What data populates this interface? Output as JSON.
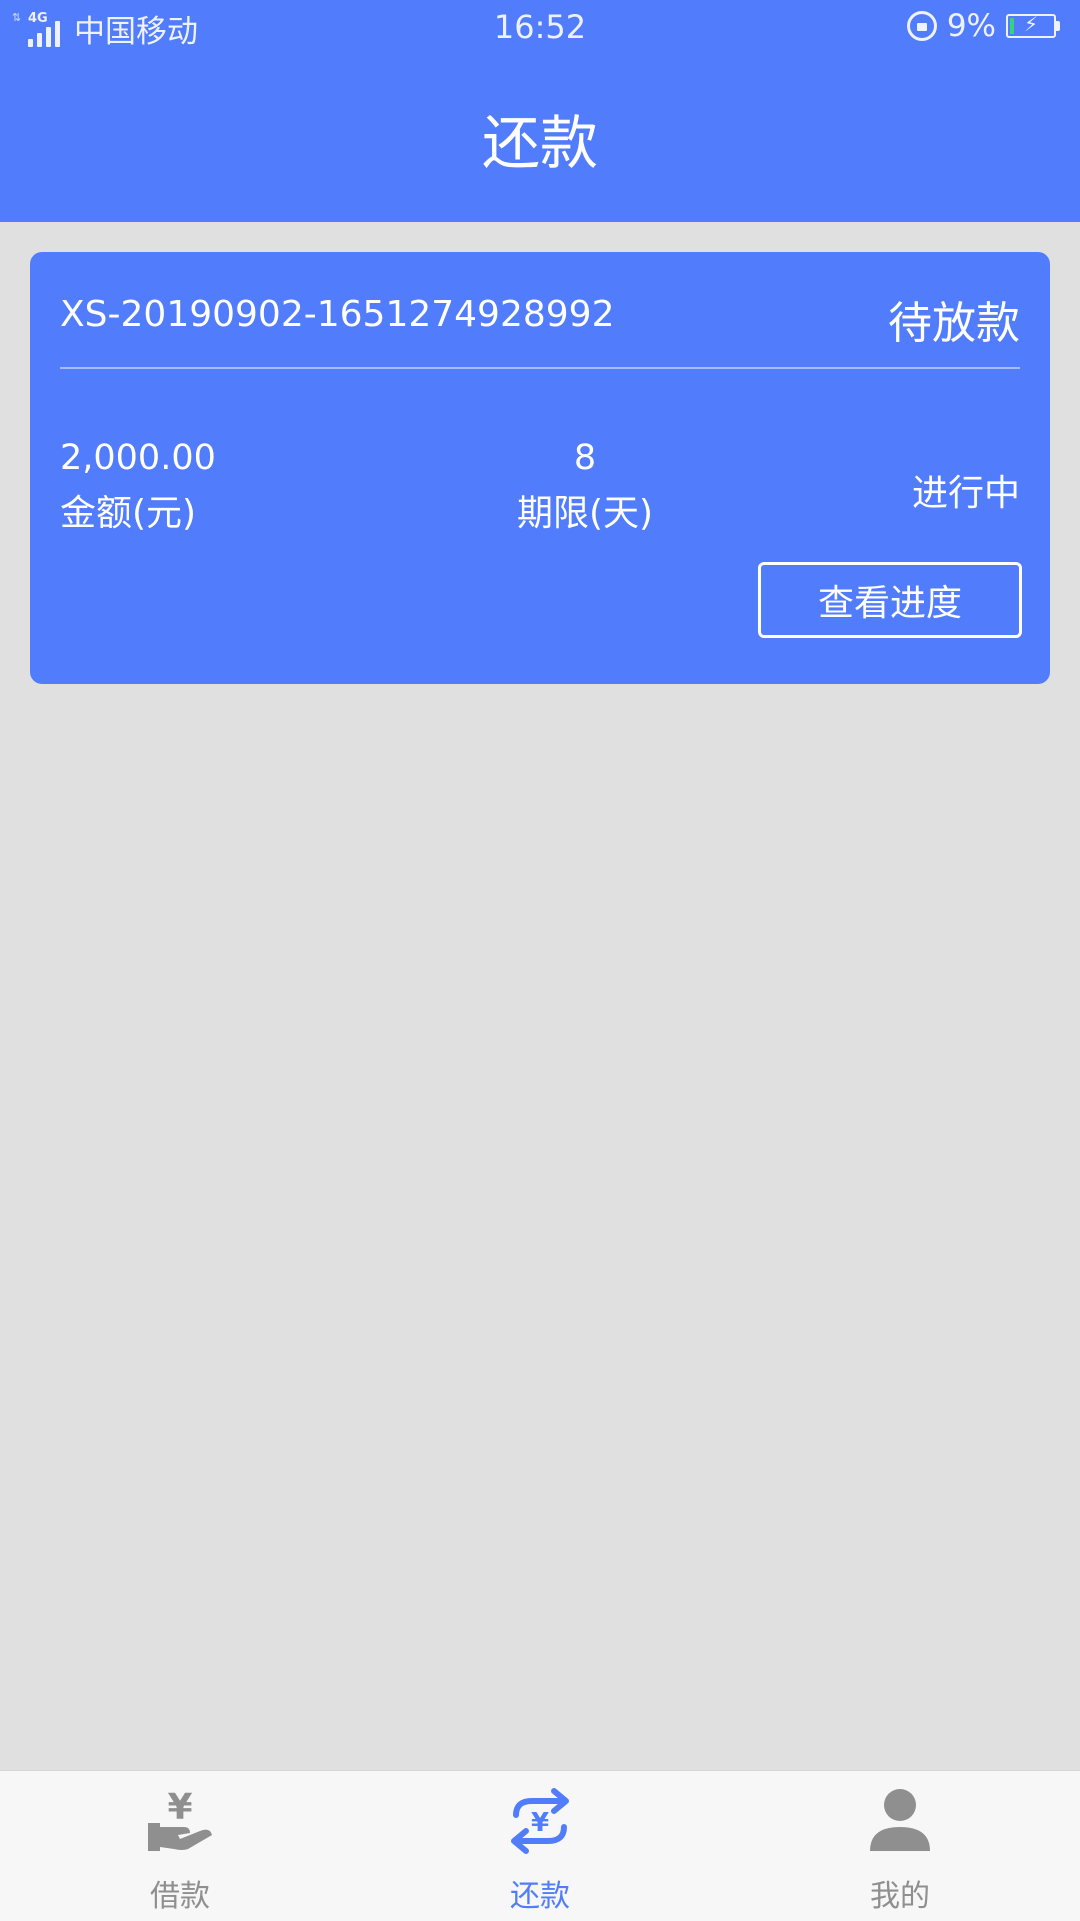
{
  "status_bar": {
    "network": "4G",
    "carrier": "中国移动",
    "time": "16:52",
    "battery_percent": "9%",
    "battery_level": 0.09
  },
  "header": {
    "title": "还款"
  },
  "order": {
    "number": "XS-20190902-1651274928992",
    "status": "待放款",
    "amount_value": "2,000.00",
    "amount_label": "金额(元)",
    "term_value": "8",
    "term_label": "期限(天)",
    "progress_status": "进行中",
    "view_button": "查看进度"
  },
  "tabbar": {
    "items": [
      {
        "label": "借款",
        "icon": "hand-yen-icon",
        "active": false
      },
      {
        "label": "还款",
        "icon": "exchange-yen-icon",
        "active": true
      },
      {
        "label": "我的",
        "icon": "person-icon",
        "active": false
      }
    ]
  },
  "colors": {
    "primary": "#517cfb",
    "background": "#e0e0e0",
    "tab_inactive": "#8f8f8f"
  }
}
